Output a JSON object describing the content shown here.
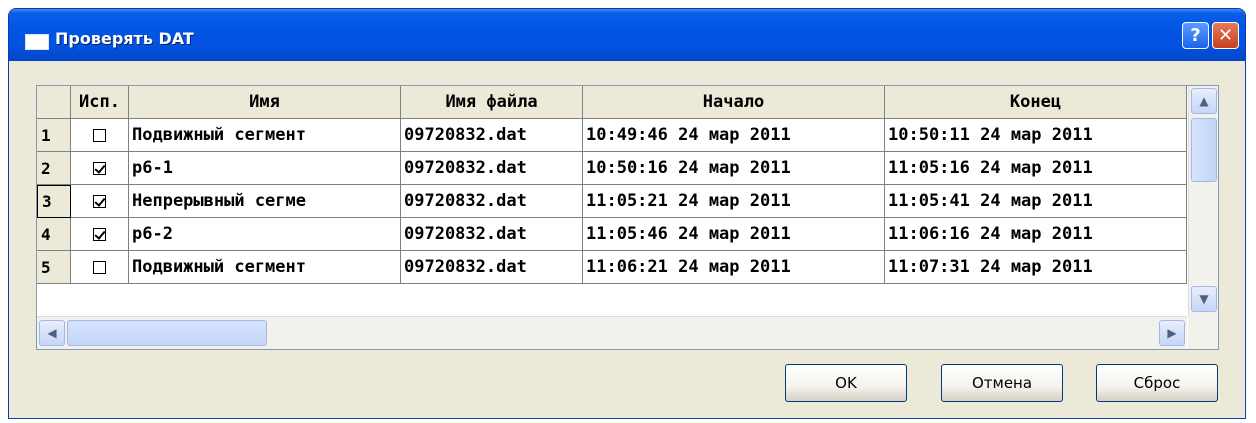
{
  "window": {
    "title": "Проверять DAT"
  },
  "titlebar": {
    "help_label": "?",
    "close_label": "✕"
  },
  "table": {
    "columns": [
      "",
      "Исп.",
      "Имя",
      "Имя файла",
      "Начало",
      "Конец"
    ],
    "rows": [
      {
        "num": "1",
        "checked": false,
        "name": "Подвижный сегмент",
        "file": "09720832.dat",
        "start": "10:49:46 24 мар 2011",
        "end": "10:50:11 24 мар 2011"
      },
      {
        "num": "2",
        "checked": true,
        "name": "р6-1",
        "file": "09720832.dat",
        "start": "10:50:16 24 мар 2011",
        "end": "11:05:16 24 мар 2011"
      },
      {
        "num": "3",
        "checked": true,
        "name": "Непрерывный сегме",
        "file": "09720832.dat",
        "start": "11:05:21 24 мар 2011",
        "end": "11:05:41 24 мар 2011"
      },
      {
        "num": "4",
        "checked": true,
        "name": "р6-2",
        "file": "09720832.dat",
        "start": "11:05:46 24 мар 2011",
        "end": "11:06:16 24 мар 2011"
      },
      {
        "num": "5",
        "checked": false,
        "name": "Подвижный сегмент",
        "file": "09720832.dat",
        "start": "11:06:21 24 мар 2011",
        "end": "11:07:31 24 мар 2011"
      }
    ],
    "current_row": "3"
  },
  "scroll": {
    "up": "▲",
    "down": "▼",
    "left": "◀",
    "right": "▶"
  },
  "buttons": {
    "ok": "OK",
    "cancel": "Отмена",
    "reset": "Сброс"
  }
}
